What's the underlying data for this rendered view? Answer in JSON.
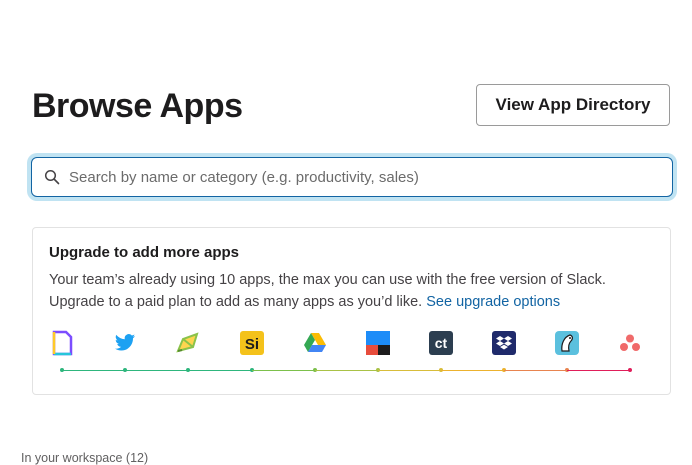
{
  "header": {
    "title": "Browse Apps",
    "directory_button": "View App Directory"
  },
  "search": {
    "placeholder": "Search by name or category (e.g. productivity, sales)"
  },
  "upgrade_card": {
    "title": "Upgrade to add more apps",
    "text": "Your team’s already using 10 apps, the max you can use with the free version of Slack. Upgrade to a paid plan to add as many apps as you’d like.",
    "link": "See upgrade options"
  },
  "apps": [
    {
      "icon": "document-app-icon",
      "color": "#7c4dff"
    },
    {
      "icon": "twitter-icon",
      "color": "#1da1f2"
    },
    {
      "icon": "pencil-app-icon",
      "color": "#8bc34a"
    },
    {
      "icon": "si-app-icon",
      "label": "Si",
      "color": "#f4c21b"
    },
    {
      "icon": "google-drive-icon",
      "color": "#34a853"
    },
    {
      "icon": "board-app-icon",
      "color": "#1d8cf8"
    },
    {
      "icon": "ct-app-icon",
      "label": "ct",
      "color": "#2c3e50"
    },
    {
      "icon": "dropbox-icon",
      "color": "#0061fe"
    },
    {
      "icon": "bird-app-icon",
      "color": "#5bc0de"
    },
    {
      "icon": "asana-icon",
      "color": "#f06a6a"
    }
  ],
  "track_colors": [
    "#2eb67d",
    "#2eb67d",
    "#2eb67d",
    "#2eb67d",
    "#7cc04b",
    "#c7c344",
    "#ecb22e",
    "#ecb22e",
    "#e8844f",
    "#e01e5a"
  ],
  "workspace": {
    "label": "In your workspace (12)"
  }
}
